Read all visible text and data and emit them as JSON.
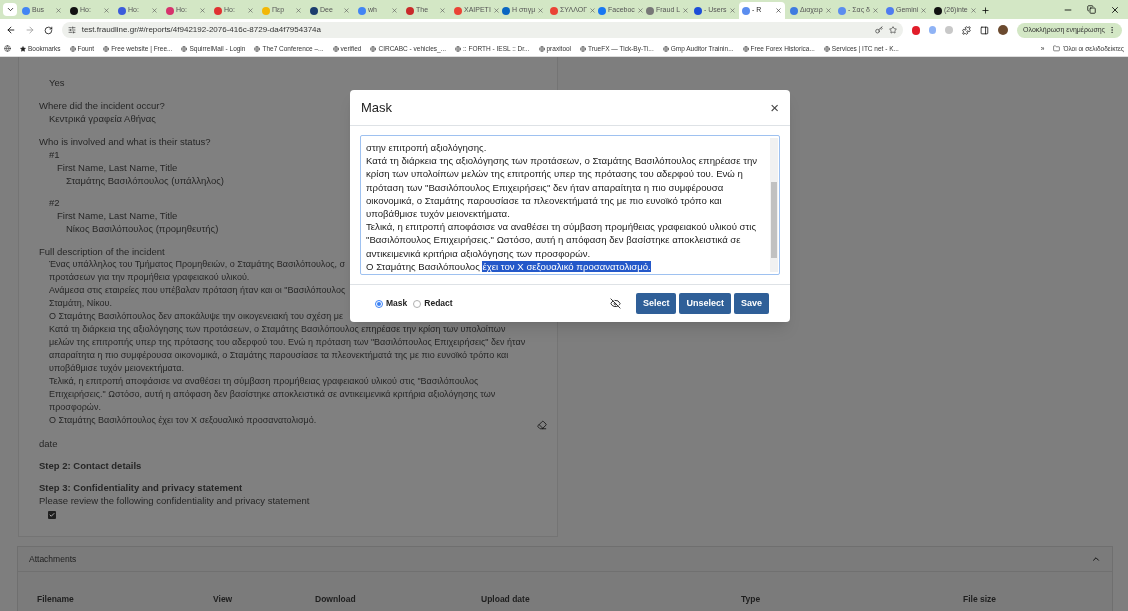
{
  "browser": {
    "tabs": [
      {
        "title": "Bus",
        "color": "#4285f4",
        "selected": false
      },
      {
        "title": "Ho:",
        "color": "#111111",
        "selected": false
      },
      {
        "title": "Ho:",
        "color": "#3b5bdb",
        "selected": false
      },
      {
        "title": "Ho:",
        "color": "#d6336c",
        "selected": false
      },
      {
        "title": "Ho:",
        "color": "#e03131",
        "selected": false
      },
      {
        "title": "Πεp",
        "color": "#f2b705",
        "selected": false
      },
      {
        "title": "Dee",
        "color": "#1c3d6e",
        "selected": false
      },
      {
        "title": "wh",
        "color": "#4285f4",
        "selected": false
      },
      {
        "title": "The",
        "color": "#c92a2a",
        "selected": false
      },
      {
        "title": "XAIPETI",
        "color": "#ea4335",
        "selected": false
      },
      {
        "title": "Η στιγμ",
        "color": "#0a66c2",
        "selected": false
      },
      {
        "title": "ΣΥΛΛΟΓ",
        "color": "#ea4335",
        "selected": false
      },
      {
        "title": "Faceboc",
        "color": "#1877f2",
        "selected": false
      },
      {
        "title": "Fraud L",
        "color": "#777777",
        "selected": false
      },
      {
        "title": "- Users",
        "color": "#1d4ed8",
        "selected": false
      },
      {
        "title": "- R",
        "color": "#5b8def",
        "selected": true
      },
      {
        "title": "Διαχειρ",
        "color": "#3f7be0",
        "selected": false
      },
      {
        "title": "- Σας δ",
        "color": "#5b8def",
        "selected": false
      },
      {
        "title": "Gemini",
        "color": "#4f7cf0",
        "selected": false
      },
      {
        "title": "(26)inte",
        "color": "#111111",
        "selected": false
      }
    ],
    "url": "test.fraudline.gr/#/reports/4f942192-2076-416c-8729-da4f7954374a",
    "update_button": "Ολοκλήρωση ενημέρωσης",
    "bookmarks": [
      "Bookmarks",
      "Fount",
      "Free website | Free...",
      "SquirrelMail - Login",
      "The7 Conference –...",
      "verified",
      "CIRCABC - vehicles_...",
      ":: FORTH - IESL :: Dr...",
      "praxitool",
      "TrueFX — Tick-By-Ti...",
      "Gmp Auditor Trainin...",
      "Free Forex Historica...",
      "Services | ITC net - K..."
    ],
    "bookmarks_more": "»",
    "all_bookmarks": "Όλοι οι σελιδοδείκτες"
  },
  "report": {
    "entries": [
      {
        "kind": "answer",
        "text": "Yes"
      },
      {
        "kind": "question",
        "text": "Where did the incident occur?"
      },
      {
        "kind": "answer",
        "text": "Κεντρικά γραφεία Αθήνας"
      },
      {
        "kind": "question",
        "text": "Who is involved and what is their status?"
      },
      {
        "kind": "index",
        "text": "#1"
      },
      {
        "kind": "field",
        "text": "First Name, Last Name, Title"
      },
      {
        "kind": "value",
        "text": "Σταμάτης Βασιλόπουλος (υπάλληλος)"
      },
      {
        "kind": "index",
        "text": "#2"
      },
      {
        "kind": "field",
        "text": "First Name, Last Name, Title"
      },
      {
        "kind": "value",
        "text": "Νίκος Βασιλόπουλος (προμηθευτής)"
      },
      {
        "kind": "question",
        "text": "Full description of the incident"
      },
      {
        "kind": "line",
        "text": "Ένας υπάλληλος του Τμήματος Προμηθειών, ο Σταμάτης Βασιλόπουλος, σ"
      },
      {
        "kind": "line",
        "text": "προτάσεων για την προμήθεια γραφειακού υλικού."
      },
      {
        "kind": "line",
        "text": "Ανάμεσα στις εταιρείες που υπέβαλαν πρόταση ήταν και οι \"Βασιλόπουλος"
      },
      {
        "kind": "line",
        "text": "Σταμάτη, Νίκου."
      },
      {
        "kind": "line",
        "text": "Ο Σταμάτης Βασιλόπουλος δεν αποκάλυψε την οικογενειακή του σχέση με"
      },
      {
        "kind": "line",
        "text": "Κατά τη διάρκεια της αξιολόγησης των προτάσεων, ο Σταμάτης Βασιλόπουλος επηρέασε την κρίση των υπολοίπων"
      },
      {
        "kind": "line",
        "text": "μελών της επιτροπής υπερ της πρότασης του αδερφού του. Ενώ η πρόταση των \"Βασιλόπουλος Επιχειρήσεις\" δεν ήταν"
      },
      {
        "kind": "line",
        "text": "απαραίτητα η πιο συμφέρουσα οικονομικά, ο Σταμάτης παρουσίασε τα πλεονεκτήματά της με πιο ευνοϊκό τρόπο και"
      },
      {
        "kind": "line",
        "text": "υποβάθμισε τυχόν μειονεκτήματα."
      },
      {
        "kind": "line",
        "text": "Τελικά, η επιτροπή αποφάσισε να αναθέσει τη σύμβαση προμήθειας γραφειακού υλικού στις \"Βασιλόπουλος"
      },
      {
        "kind": "line",
        "text": "Επιχειρήσεις.\" Ωστόσο, αυτή η απόφαση δεν βασίστηκε αποκλειστικά σε αντικειμενικά κριτήρια αξιολόγησης των"
      },
      {
        "kind": "line",
        "text": "προσφορών."
      },
      {
        "kind": "line",
        "text": "Ο Σταμάτης Βασιλόπουλος έχει τον Χ σεξουαλικό προσανατολισμό."
      },
      {
        "kind": "question",
        "text": "date"
      },
      {
        "kind": "step",
        "text": "Step 2: Contact details"
      },
      {
        "kind": "step",
        "text": "Step 3: Confidentiality and privacy statement"
      },
      {
        "kind": "note",
        "text": "Please review the following confidentiality and privacy statement"
      }
    ],
    "agreement_checked": true
  },
  "attachments": {
    "title": "Attachments",
    "expanded": true,
    "columns": [
      "Filename",
      "View",
      "Download",
      "Upload date",
      "Type",
      "File size"
    ]
  },
  "modal": {
    "title": "Mask",
    "close": "×",
    "lines": [
      "στην επιτροπή αξιολόγησης.",
      "Κατά τη διάρκεια της αξιολόγησης των προτάσεων, ο Σταμάτης Βασιλόπουλος επηρέασε την",
      "κρίση των υπολοίπων μελών της επιτροπής υπερ της πρότασης του αδερφού του. Ενώ η",
      "πρόταση των \"Βασιλόπουλος Επιχειρήσεις\" δεν ήταν απαραίτητα η πιο συμφέρουσα",
      "οικονομικά, ο Σταμάτης παρουσίασε τα πλεονεκτήματά της με πιο ευνοϊκό τρόπο και",
      "υποβάθμισε τυχόν μειονεκτήματα.",
      "Τελικά, η επιτροπή αποφάσισε να αναθέσει τη σύμβαση προμήθειας γραφειακού υλικού στις",
      "\"Βασιλόπουλος Επιχειρήσεις.\" Ωστόσο, αυτή η απόφαση δεν βασίστηκε αποκλειστικά σε",
      "αντικειμενικά κριτήρια αξιολόγησης των προσφορών."
    ],
    "last_line_before": "Ο Σταμάτης Βασιλόπουλος ",
    "last_line_selected": "έχει τον Χ σεξουαλικό προσανατολισμό.",
    "modes": [
      {
        "label": "Mask",
        "selected": true
      },
      {
        "label": "Redact",
        "selected": false
      }
    ],
    "buttons": [
      "Select",
      "Unselect",
      "Save"
    ]
  }
}
